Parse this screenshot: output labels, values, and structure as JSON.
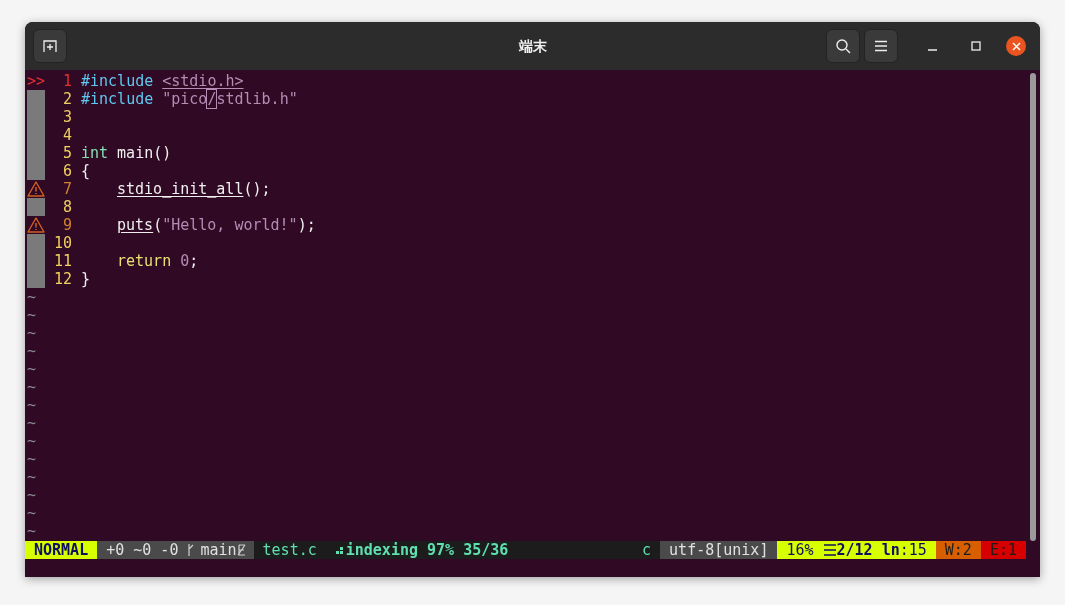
{
  "window": {
    "title": "端末"
  },
  "lines": [
    {
      "kind": "current",
      "sign_text": ">>",
      "number": "1",
      "segments": [
        {
          "kind": "preproc",
          "text": "#include"
        },
        {
          "kind": "include",
          "text": "<stdio.h>",
          "space_before": true
        }
      ]
    },
    {
      "kind": "plain",
      "number": "2",
      "segments": [
        {
          "kind": "preproc",
          "text": "#include"
        },
        {
          "kind": "string",
          "text": "\"pico",
          "space_before": true
        },
        {
          "kind": "cursor",
          "text": "/"
        },
        {
          "kind": "string",
          "text": "stdlib.h\""
        }
      ]
    },
    {
      "kind": "plain",
      "number": "3"
    },
    {
      "kind": "plain",
      "number": "4"
    },
    {
      "kind": "plain",
      "number": "5",
      "segments": [
        {
          "kind": "type",
          "text": "int"
        },
        {
          "kind": "plain",
          "text": "main()",
          "space_before": true
        }
      ]
    },
    {
      "kind": "plain",
      "number": "6",
      "segments": [
        {
          "kind": "plain",
          "text": "{"
        }
      ]
    },
    {
      "kind": "warning",
      "number": "7",
      "indented": true,
      "segments": [
        {
          "kind": "call",
          "text": "stdio_init_all"
        },
        {
          "kind": "plain",
          "text": "();"
        }
      ]
    },
    {
      "kind": "plain",
      "number": "8"
    },
    {
      "kind": "warning",
      "number": "9",
      "indented": true,
      "segments": [
        {
          "kind": "call",
          "text": "puts"
        },
        {
          "kind": "plain",
          "text": "("
        },
        {
          "kind": "string",
          "text": "\"Hello, world!\""
        },
        {
          "kind": "plain",
          "text": ");"
        }
      ]
    },
    {
      "kind": "plain",
      "number": "10"
    },
    {
      "kind": "plain",
      "number": "11",
      "indented": true,
      "segments": [
        {
          "kind": "keyword",
          "text": "return"
        },
        {
          "kind": "number",
          "text": "0",
          "space_before": true
        },
        {
          "kind": "plain",
          "text": ";"
        }
      ]
    },
    {
      "kind": "plain",
      "number": "12",
      "segments": [
        {
          "kind": "plain",
          "text": "}"
        }
      ]
    }
  ],
  "empty_lines": [
    "~",
    "~",
    "~",
    "~",
    "~",
    "~",
    "~",
    "~",
    "~",
    "~",
    "~",
    "~",
    "~",
    "~"
  ],
  "status_bar": {
    "mode": "NORMAL",
    "diff": "+0 ~0 -0",
    "branch": "main",
    "file": "test.c",
    "lsp": "indexing 97% 35/36",
    "filetype": "c",
    "encoding": "utf-8[unix]",
    "percent": "16%",
    "position": "2/12",
    "column_label": "ln",
    "column": ":15",
    "warnings": "W:2",
    "errors": "E:1"
  }
}
